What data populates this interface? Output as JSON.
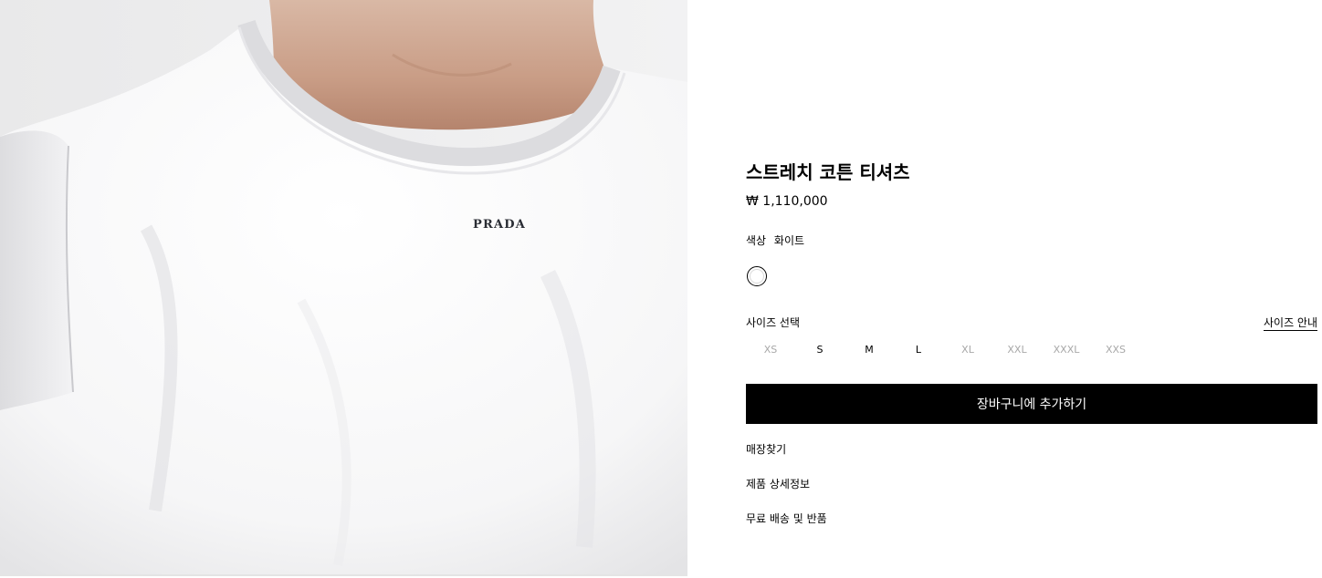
{
  "product_image": {
    "alt": "Stretch cotton t-shirt, white, worn by model",
    "logo_text": "PRADA"
  },
  "product": {
    "title": "스트레치 코튼 티셔츠",
    "price": "₩ 1,110,000",
    "color_label": "색상",
    "color_value": "화이트",
    "swatch_color": "#ffffff"
  },
  "size": {
    "label": "사이즈 선택",
    "guide_label": "사이즈 안내",
    "options": [
      {
        "label": "XS",
        "available": false
      },
      {
        "label": "S",
        "available": true
      },
      {
        "label": "M",
        "available": true
      },
      {
        "label": "L",
        "available": true
      },
      {
        "label": "XL",
        "available": false
      },
      {
        "label": "XXL",
        "available": false
      },
      {
        "label": "XXXL",
        "available": false
      },
      {
        "label": "XXS",
        "available": false
      }
    ]
  },
  "actions": {
    "add_to_cart": "장바구니에 추가하기"
  },
  "links": {
    "store_finder": "매장찾기",
    "product_details": "제품 상세정보",
    "shipping_returns": "무료 배송 및 반품"
  },
  "colors": {
    "button_bg": "#000000",
    "button_text": "#ffffff",
    "unavailable_size": "#a8a8a8",
    "image_bg": "#eeeeee"
  }
}
